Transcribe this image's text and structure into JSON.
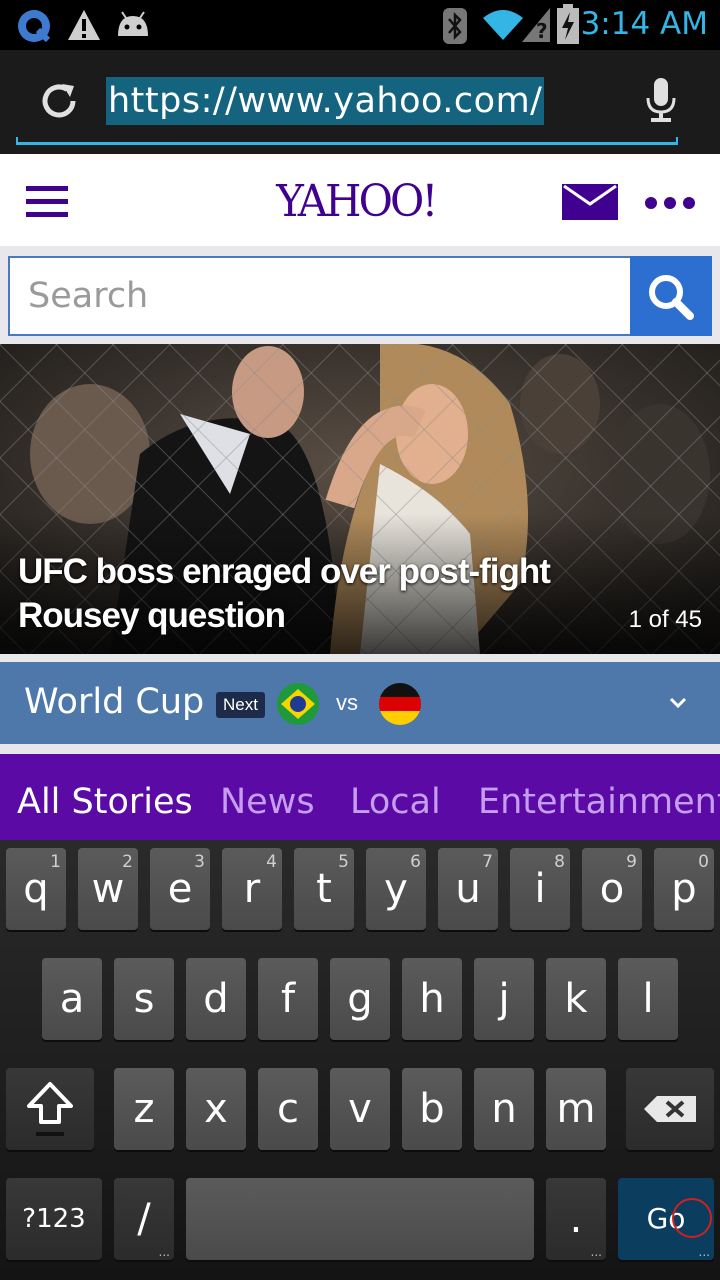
{
  "status_bar": {
    "time": "3:14 AM",
    "icons": [
      "app-icon",
      "warning-icon",
      "android-debug-icon",
      "bluetooth-icon",
      "wifi-icon",
      "signal-unknown-icon",
      "battery-charging-icon"
    ]
  },
  "browser": {
    "url": "https://www.yahoo.com/",
    "reload_icon": "reload-icon",
    "mic_icon": "mic-icon"
  },
  "yahoo": {
    "logo": "YAHOO!",
    "search_placeholder": "Search",
    "hero": {
      "title": "UFC boss enraged over post-fight Rousey question",
      "counter": "1 of 45"
    },
    "world_cup": {
      "title": "World Cup",
      "badge": "Next",
      "vs": "vs",
      "teams": [
        "brazil-flag",
        "germany-flag"
      ]
    },
    "tabs": [
      {
        "label": "All Stories",
        "active": true
      },
      {
        "label": "News",
        "active": false
      },
      {
        "label": "Local",
        "active": false
      },
      {
        "label": "Entertainment",
        "active": false
      }
    ]
  },
  "keyboard": {
    "row1": [
      {
        "key": "q",
        "hint": "1"
      },
      {
        "key": "w",
        "hint": "2"
      },
      {
        "key": "e",
        "hint": "3"
      },
      {
        "key": "r",
        "hint": "4"
      },
      {
        "key": "t",
        "hint": "5"
      },
      {
        "key": "y",
        "hint": "6"
      },
      {
        "key": "u",
        "hint": "7"
      },
      {
        "key": "i",
        "hint": "8"
      },
      {
        "key": "o",
        "hint": "9"
      },
      {
        "key": "p",
        "hint": "0"
      }
    ],
    "row2": [
      "a",
      "s",
      "d",
      "f",
      "g",
      "h",
      "j",
      "k",
      "l"
    ],
    "row3": [
      "z",
      "x",
      "c",
      "v",
      "b",
      "n",
      "m"
    ],
    "symbols_label": "?123",
    "slash_label": "/",
    "period_label": ".",
    "go_label": "Go"
  },
  "colors": {
    "yahoo_purple": "#400090",
    "search_blue": "#2c6fd1",
    "holo_blue": "#33b5e5",
    "worldcup_blue": "#4d78a9",
    "tabs_purple": "#5b0aa6"
  }
}
